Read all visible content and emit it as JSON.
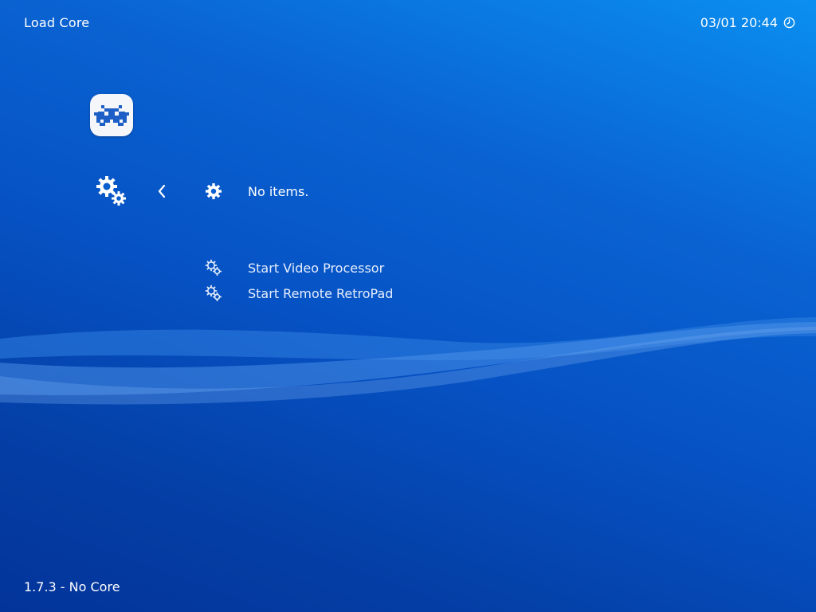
{
  "header": {
    "title": "Load Core",
    "datetime": "03/01 20:44",
    "clock_icon": "clock-icon"
  },
  "footer": {
    "version": "1.7.3 - No Core"
  },
  "sidebar": {
    "main_icon": "retroarch-invader-icon",
    "settings_icon": "settings-gears-icon",
    "back_icon": "chevron-left-icon"
  },
  "list": {
    "empty_label": "No items.",
    "empty_icon": "gear-icon",
    "items": [
      {
        "label": "Start Video Processor",
        "icon": "gears-icon"
      },
      {
        "label": "Start Remote RetroPad",
        "icon": "gears-icon"
      }
    ]
  },
  "colors": {
    "background_top": "#0a8ff0",
    "background_bottom": "#03349a",
    "text": "#ffffff"
  }
}
